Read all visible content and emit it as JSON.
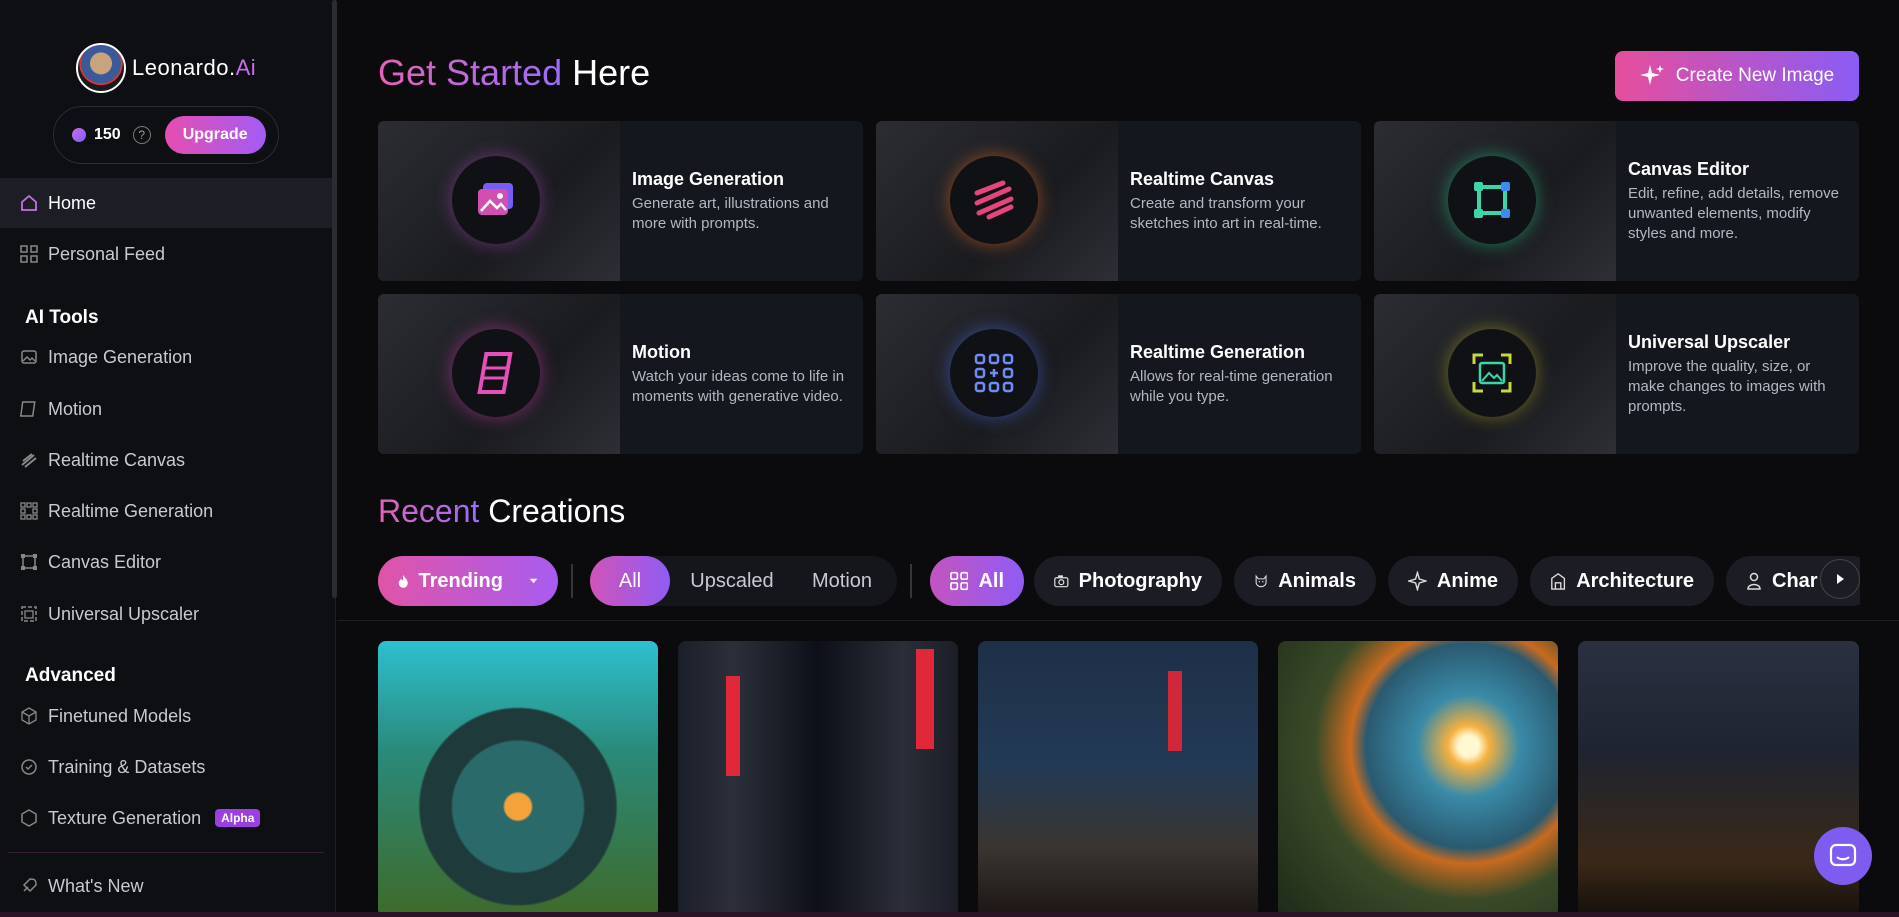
{
  "sidebar": {
    "brand": {
      "name": "Leonardo.",
      "suffix": "Ai"
    },
    "credits": "150",
    "help": "?",
    "upgrade_label": "Upgrade",
    "home": "Home",
    "personal_feed": "Personal Feed",
    "ai_tools_title": "AI Tools",
    "ai_tools": [
      "Image Generation",
      "Motion",
      "Realtime Canvas",
      "Realtime Generation",
      "Canvas Editor",
      "Universal Upscaler"
    ],
    "advanced_title": "Advanced",
    "advanced": [
      "Finetuned Models",
      "Training & Datasets",
      "Texture Generation"
    ],
    "alpha_badge": "Alpha",
    "whats_new": "What's New"
  },
  "main": {
    "get_started": {
      "part1": "Get Started",
      "part2": "Here"
    },
    "create_button": "Create New Image",
    "cards": [
      {
        "title": "Image Generation",
        "desc": "Generate art, illustrations and more with prompts."
      },
      {
        "title": "Realtime Canvas",
        "desc": "Create and transform your sketches into art in real-time."
      },
      {
        "title": "Canvas Editor",
        "desc": "Edit, refine, add details, remove unwanted elements, modify styles and more."
      },
      {
        "title": "Motion",
        "desc": "Watch your ideas come to life in moments with generative video."
      },
      {
        "title": "Realtime Generation",
        "desc": "Allows for real-time generation while you type."
      },
      {
        "title": "Universal Upscaler",
        "desc": "Improve the quality, size, or make changes to images with prompts."
      }
    ],
    "recent": {
      "part1": "Recent",
      "part2": "Creations"
    },
    "sort": "Trending",
    "type_filters": [
      "All",
      "Upscaled",
      "Motion"
    ],
    "category_all": "All",
    "categories": [
      "Photography",
      "Animals",
      "Anime",
      "Architecture",
      "Char"
    ]
  },
  "colors": {
    "accent_pink": "#e364b7",
    "accent_purple": "#9a6dfa",
    "sidebar_bg": "#0e0f13",
    "page_bg": "#0b0b0e"
  }
}
